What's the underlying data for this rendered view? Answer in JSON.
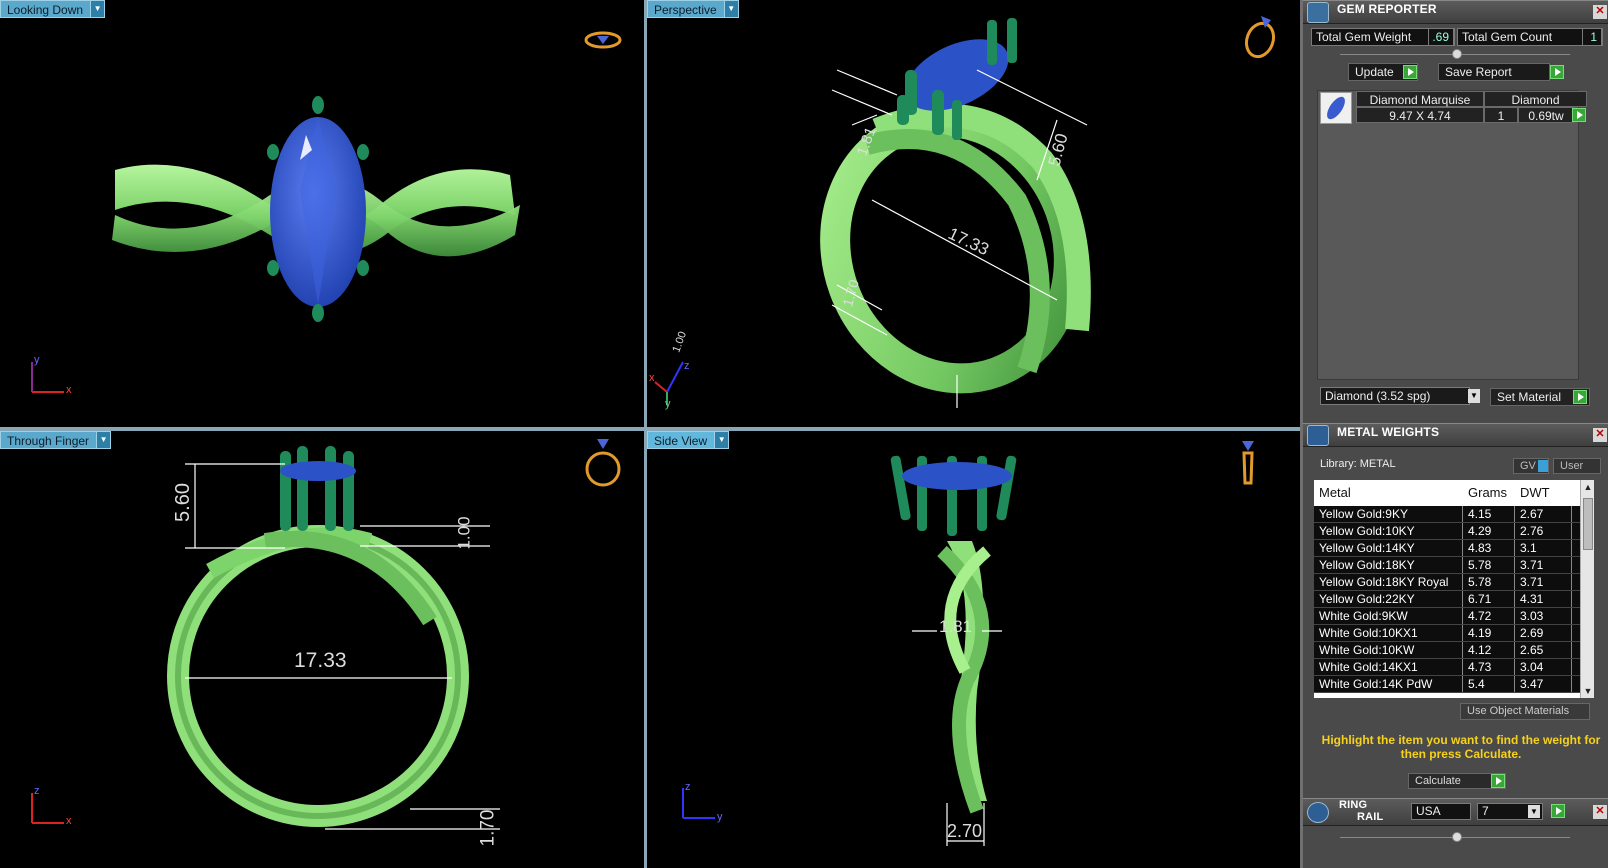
{
  "viewports": {
    "top_left": {
      "label": "Looking Down",
      "axis_a": "y",
      "axis_b": "x"
    },
    "top_right": {
      "label": "Perspective",
      "axis_a": "z",
      "axis_b": "x",
      "axis_c": "y",
      "dims": [
        "1.00",
        "1.81",
        "5.60",
        "17.33",
        "1.70"
      ]
    },
    "bottom_left": {
      "label": "Through Finger",
      "axis_a": "z",
      "axis_b": "x",
      "dims": [
        "5.60",
        "1.00",
        "17.33",
        "1.70"
      ]
    },
    "bottom_right": {
      "label": "Side View",
      "axis_a": "z",
      "axis_b": "y",
      "dims": [
        "1.81",
        "2.70"
      ]
    }
  },
  "gem_reporter": {
    "title": "GEM REPORTER",
    "total_weight_label": "Total Gem Weight",
    "total_weight_value": ".69",
    "total_count_label": "Total Gem Count",
    "total_count_value": "1",
    "update_label": "Update",
    "save_report_label": "Save Report",
    "gem": {
      "name": "Diamond Marquise",
      "material": "Diamond",
      "size": "9.47 X 4.74",
      "count": "1",
      "weight": "0.69tw"
    },
    "material_select": "Diamond    (3.52 spg)",
    "set_material_label": "Set Material"
  },
  "metal_weights": {
    "title": "METAL WEIGHTS",
    "library_label": "Library: METAL",
    "gv_label": "GV",
    "user_label": "User",
    "columns": [
      "Metal",
      "Grams",
      "DWT"
    ],
    "rows": [
      [
        "Yellow Gold:9KY",
        "4.15",
        "2.67"
      ],
      [
        "Yellow Gold:10KY",
        "4.29",
        "2.76"
      ],
      [
        "Yellow Gold:14KY",
        "4.83",
        "3.1"
      ],
      [
        "Yellow Gold:18KY",
        "5.78",
        "3.71"
      ],
      [
        "Yellow Gold:18KY Royal",
        "5.78",
        "3.71"
      ],
      [
        "Yellow Gold:22KY",
        "6.71",
        "4.31"
      ],
      [
        "White Gold:9KW",
        "4.72",
        "3.03"
      ],
      [
        "White Gold:10KX1",
        "4.19",
        "2.69"
      ],
      [
        "White Gold:10KW",
        "4.12",
        "2.65"
      ],
      [
        "White Gold:14KX1",
        "4.73",
        "3.04"
      ],
      [
        "White Gold:14K PdW",
        "5.4",
        "3.47"
      ]
    ],
    "use_object_materials_label": "Use Object Materials",
    "hint": "Highlight the item you want to find the weight for then press Calculate.",
    "calculate_label": "Calculate"
  },
  "ring_rail": {
    "title_line1": "RING",
    "title_line2": "RAIL",
    "standard": "USA",
    "size": "7"
  },
  "colors": {
    "ring_green": "#8fe07a",
    "prong_green": "#1f8a5a",
    "gem_blue": "#2c52c8",
    "label_blue": "#5aa8cc",
    "hint_yellow": "#f7d21a"
  }
}
